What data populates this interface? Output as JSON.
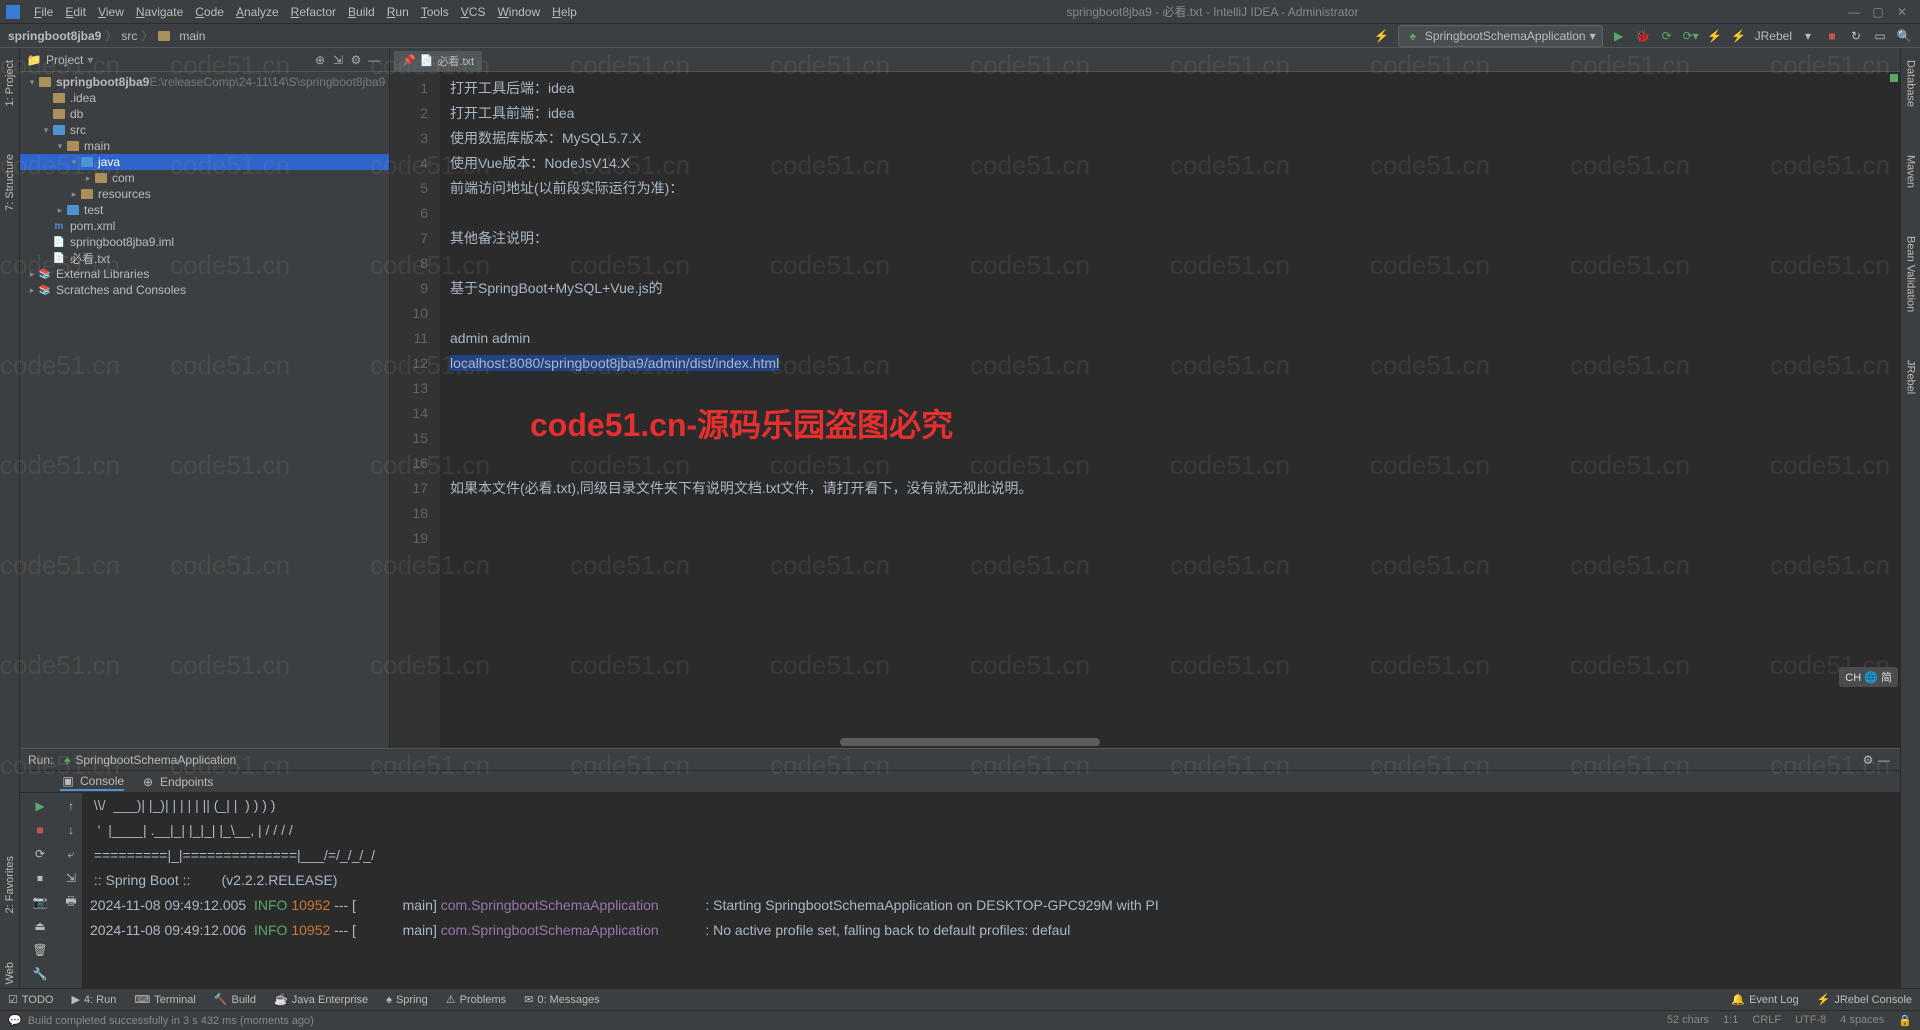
{
  "menubar": {
    "items": [
      "File",
      "Edit",
      "View",
      "Navigate",
      "Code",
      "Analyze",
      "Refactor",
      "Build",
      "Run",
      "Tools",
      "VCS",
      "Window",
      "Help"
    ],
    "title": "springboot8jba9 - 必看.txt - IntelliJ IDEA - Administrator"
  },
  "breadcrumb": {
    "parts": [
      "springboot8jba9",
      "src",
      "main"
    ]
  },
  "toolbar": {
    "run_config": "SpringbootSchemaApplication",
    "jrebel_label": "JRebel"
  },
  "project_panel": {
    "title": "Project",
    "root": {
      "name": "springboot8jba9",
      "path": "E:\\releaseComp\\24-11\\14\\S\\springboot8jba9"
    },
    "nodes": [
      {
        "indent": 1,
        "caret": "",
        "icon": "folder",
        "label": ".idea"
      },
      {
        "indent": 1,
        "caret": "",
        "icon": "folder",
        "label": "db"
      },
      {
        "indent": 1,
        "caret": "down",
        "icon": "folder-src",
        "label": "src"
      },
      {
        "indent": 2,
        "caret": "down",
        "icon": "folder",
        "label": "main"
      },
      {
        "indent": 3,
        "caret": "down",
        "icon": "folder-src",
        "label": "java",
        "selected": true
      },
      {
        "indent": 4,
        "caret": "right",
        "icon": "folder",
        "label": "com"
      },
      {
        "indent": 3,
        "caret": "right",
        "icon": "folder",
        "label": "resources"
      },
      {
        "indent": 2,
        "caret": "right",
        "icon": "folder-src",
        "label": "test"
      },
      {
        "indent": 1,
        "caret": "",
        "icon": "maven",
        "label": "pom.xml"
      },
      {
        "indent": 1,
        "caret": "",
        "icon": "file",
        "label": "springboot8jba9.iml"
      },
      {
        "indent": 1,
        "caret": "",
        "icon": "file",
        "label": "必看.txt"
      }
    ],
    "extra": [
      {
        "caret": "right",
        "icon": "lib",
        "label": "External Libraries"
      },
      {
        "caret": "right",
        "icon": "scratch",
        "label": "Scratches and Consoles"
      }
    ]
  },
  "editor": {
    "tab": {
      "name": "必看.txt",
      "pinned": true
    },
    "lines": [
      "打开工具后端：idea",
      "打开工具前端：idea",
      "使用数据库版本：MySQL5.7.X",
      "使用Vue版本：NodeJsV14.X",
      "前端访问地址(以前段实际运行为准)：",
      "",
      "其他备注说明：",
      "",
      "基于SpringBoot+MySQL+Vue.js的",
      "",
      "admin admin",
      "localhost:8080/springboot8jba9/admin/dist/index.html",
      "",
      "",
      "",
      "",
      "如果本文件(必看.txt),同级目录文件夹下有说明文档.txt文件，请打开看下，没有就无视此说明。",
      "",
      ""
    ],
    "selected_line_index": 11
  },
  "run": {
    "title_prefix": "Run:",
    "config": "SpringbootSchemaApplication",
    "tabs": [
      "Console",
      "Endpoints"
    ],
    "lines": [
      {
        "raw": " \\\\/  ___)| |_)| | | | | || (_| |  ) ) ) )"
      },
      {
        "raw": "  '  |____| .__|_| |_|_| |_\\__, | / / / /"
      },
      {
        "raw": " =========|_|==============|___/=/_/_/_/"
      },
      {
        "raw": " :: Spring Boot ::        (v2.2.2.RELEASE)"
      },
      {
        "raw": ""
      },
      {
        "ts": "2024-11-08 09:49:12.005",
        "level": "INFO",
        "pid": "10952",
        "thread": "main",
        "cls": "com.SpringbootSchemaApplication",
        "msg": ": Starting SpringbootSchemaApplication on DESKTOP-GPC929M with PI"
      },
      {
        "ts": "2024-11-08 09:49:12.006",
        "level": "INFO",
        "pid": "10952",
        "thread": "main",
        "cls": "com.SpringbootSchemaApplication",
        "msg": ": No active profile set, falling back to default profiles: defaul"
      }
    ]
  },
  "toolwindows_bottom": {
    "left": [
      "TODO",
      "4: Run",
      "Terminal",
      "Build",
      "Java Enterprise",
      "Spring",
      "Problems",
      "0: Messages"
    ],
    "right": [
      "Event Log",
      "JRebel Console"
    ]
  },
  "statusbar": {
    "message": "Build completed successfully in 3 s 432 ms (moments ago)",
    "right": [
      "52 chars",
      "1:1",
      "CRLF",
      "UTF-8",
      "4 spaces"
    ]
  },
  "left_tool_tabs": [
    "1: Project",
    "7: Structure"
  ],
  "left_tool_tabs_b": [
    "2: Favorites",
    "Web"
  ],
  "right_tool_tabs": [
    "Database",
    "Maven",
    "Bean Validation",
    "JRebel"
  ],
  "ime": "CH 🌐 简",
  "watermark_red": "code51.cn-源码乐园盗图必究",
  "watermark_grey": "code51.cn"
}
